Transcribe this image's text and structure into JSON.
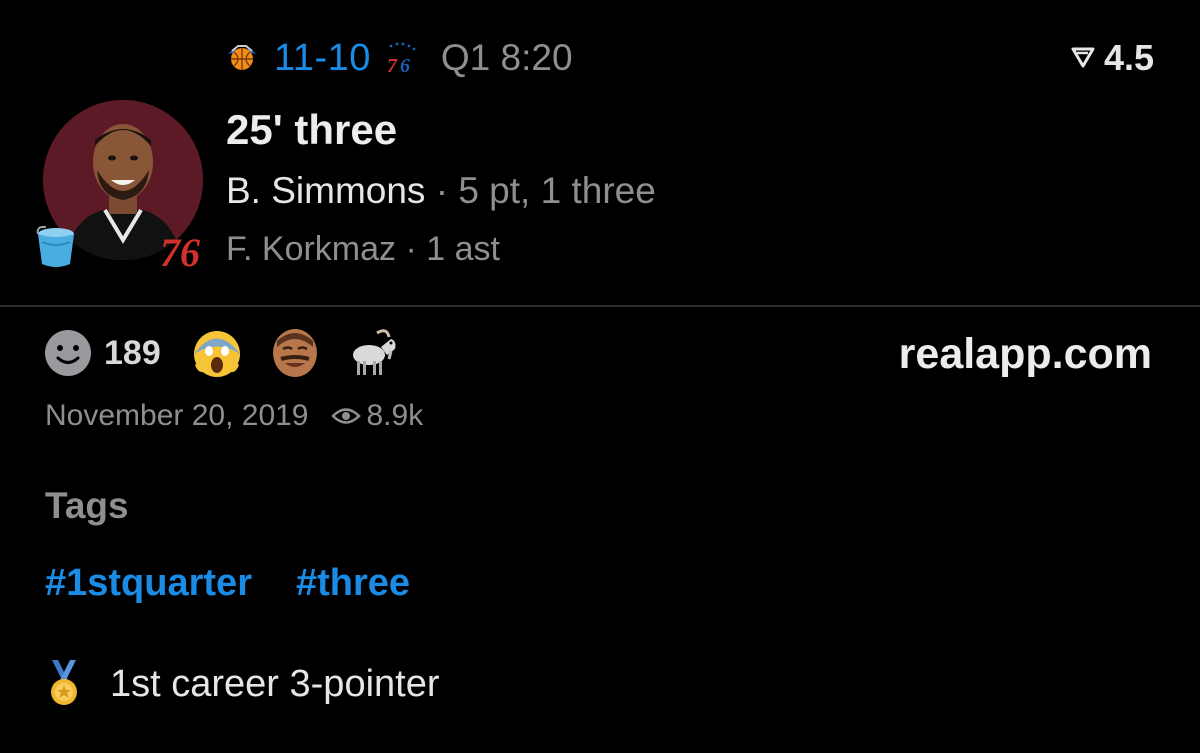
{
  "header": {
    "score": "11-10",
    "clock": "Q1 8:20",
    "home_team_logo": "76",
    "away_team_icon": "knicks-basketball-icon",
    "vote_value": "4.5"
  },
  "play": {
    "title": "25' three",
    "scorer_name": "B. Simmons",
    "separator": "·",
    "scorer_stat": "5 pt, 1 three",
    "assist_text": "F. Korkmaz · 1 ast",
    "team_badge": "76",
    "colors": {
      "avatar_bg": "#5c1a27",
      "accent_blue": "#1a8ce6",
      "team_red": "#d0312d"
    }
  },
  "reactions": {
    "count": "189",
    "emojis": [
      "screaming-face-emoji",
      "laughing-man-emoji",
      "goat-emoji"
    ]
  },
  "site": "realapp.com",
  "meta": {
    "date": "November 20, 2019",
    "views": "8.9k"
  },
  "tags": {
    "title": "Tags",
    "items": [
      "#1stquarter",
      "#three"
    ]
  },
  "achievement": {
    "text": "1st career 3-pointer",
    "icon": "medal-icon"
  }
}
